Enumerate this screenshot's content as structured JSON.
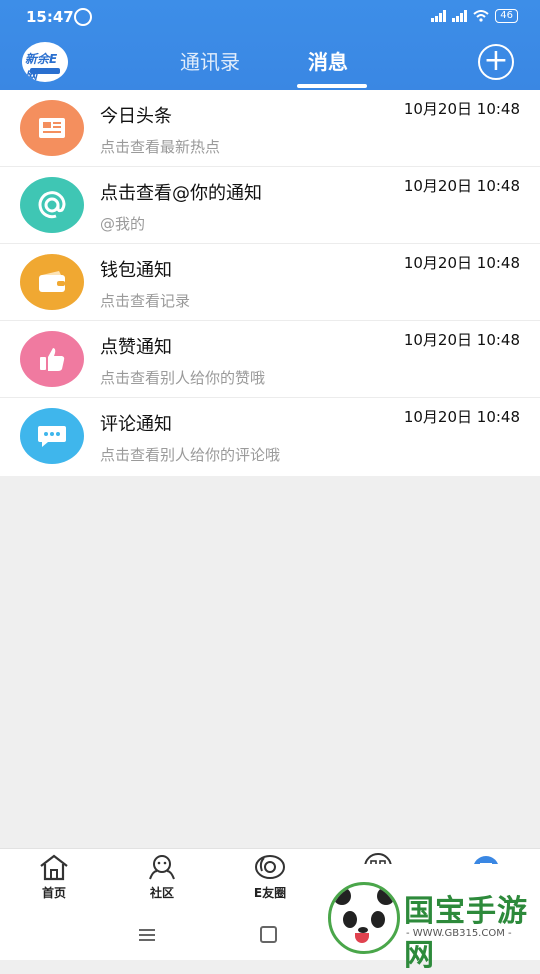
{
  "status_bar": {
    "time": "15:47",
    "battery": "46"
  },
  "header": {
    "logo_text": "新余E网",
    "tabs": [
      {
        "label": "通讯录"
      },
      {
        "label": "消息"
      }
    ],
    "active_tab": "消息"
  },
  "messages": [
    {
      "title": "今日头条",
      "subtitle": "点击查看最新热点",
      "time": "10月20日 10:48",
      "icon": "newspaper-icon",
      "color": "#f48f5e"
    },
    {
      "title": "点击查看@你的通知",
      "subtitle": "@我的",
      "time": "10月20日 10:48",
      "icon": "at-sign-icon",
      "color": "#3fc6b4"
    },
    {
      "title": "钱包通知",
      "subtitle": "点击查看记录",
      "time": "10月20日 10:48",
      "icon": "wallet-icon",
      "color": "#f0a832"
    },
    {
      "title": "点赞通知",
      "subtitle": "点击查看别人给你的赞哦",
      "time": "10月20日 10:48",
      "icon": "thumbs-up-icon",
      "color": "#f07aa0"
    },
    {
      "title": "评论通知",
      "subtitle": "点击查看别人给你的评论哦",
      "time": "10月20日 10:48",
      "icon": "comment-icon",
      "color": "#3fb6ec"
    }
  ],
  "bottom_nav": [
    {
      "label": "首页",
      "icon": "home-icon"
    },
    {
      "label": "社区",
      "icon": "community-icon"
    },
    {
      "label": "E友圈",
      "icon": "circle-icon"
    },
    {
      "label": "",
      "icon": "apps-icon"
    },
    {
      "label": "",
      "icon": "messages-icon"
    }
  ],
  "watermark": {
    "title": "国宝手游网",
    "url": "- WWW.GB315.COM -"
  },
  "colors": {
    "header_blue": "#3a87e3",
    "background": "#efefef"
  }
}
